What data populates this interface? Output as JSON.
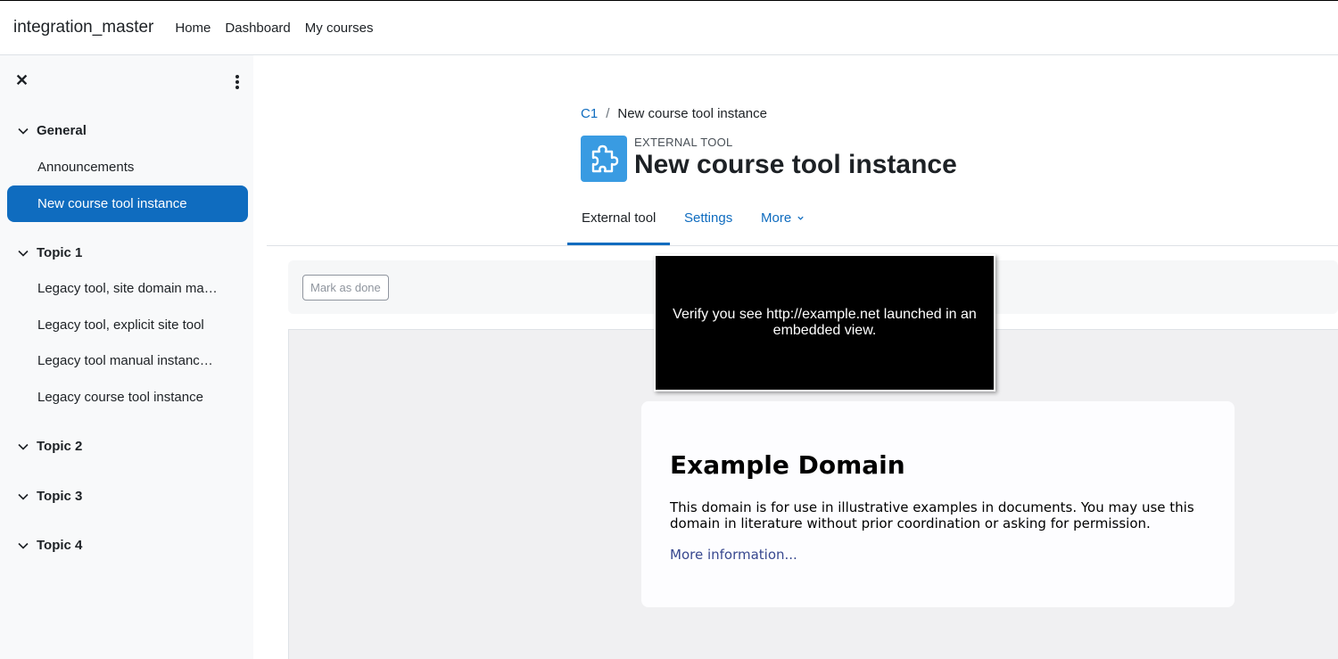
{
  "navbar": {
    "brand": "integration_master",
    "links": [
      "Home",
      "Dashboard",
      "My courses"
    ]
  },
  "drawer": {
    "sections": [
      {
        "label": "General",
        "items": [
          "Announcements",
          "New course tool instance"
        ]
      },
      {
        "label": "Topic 1",
        "items": [
          "Legacy tool, site domain ma…",
          "Legacy tool, explicit site tool",
          "Legacy tool manual instanc…",
          "Legacy course tool instance"
        ]
      },
      {
        "label": "Topic 2",
        "items": []
      },
      {
        "label": "Topic 3",
        "items": []
      },
      {
        "label": "Topic 4",
        "items": []
      }
    ],
    "active_item": "New course tool instance"
  },
  "breadcrumb": {
    "course": "C1",
    "separator": "/",
    "current": "New course tool instance"
  },
  "activity": {
    "type": "EXTERNAL TOOL",
    "title": "New course tool instance",
    "icon": "puzzle-icon"
  },
  "tabs": {
    "external_tool": "External tool",
    "settings": "Settings",
    "more": "More"
  },
  "completion": {
    "mark_done": "Mark as done"
  },
  "embedded": {
    "title": "Example Domain",
    "text": "This domain is for use in illustrative examples in documents. You may use this domain in literature without prior coordination or asking for permission.",
    "link": "More information..."
  },
  "overlay": {
    "message": "Verify you see http://example.net launched in an embedded view."
  },
  "colors": {
    "accent": "#0f6cbf",
    "icon_bg": "#399be2",
    "drawer_bg": "#f8f9fa"
  }
}
